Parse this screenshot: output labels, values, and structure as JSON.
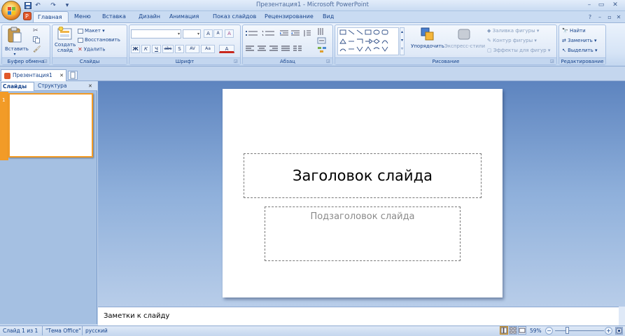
{
  "window": {
    "title": "Презентация1 - Microsoft PowerPoint",
    "minimize": "–",
    "restore": "▭",
    "close": "✕",
    "inner_minimize": "–",
    "inner_restore": "▫",
    "inner_close": "✕",
    "help": "?"
  },
  "qat": {
    "undo": "↶",
    "redo": "↷",
    "customize": "▾"
  },
  "tabs": [
    "Главная",
    "Меню",
    "Вставка",
    "Дизайн",
    "Анимация",
    "Показ слайдов",
    "Рецензирование",
    "Вид"
  ],
  "ribbon": {
    "clipboard": {
      "paste": "Вставить",
      "label": "Буфер обмена"
    },
    "slides": {
      "new_slide": "Создать слайд",
      "layout": "Макет",
      "reset": "Восстановить",
      "delete": "Удалить",
      "label": "Слайды"
    },
    "font": {
      "label": "Шрифт",
      "bold": "Ж",
      "italic": "К",
      "underline": "Ч",
      "strike": "abc",
      "shadow": "S",
      "spacing": "AV",
      "case": "Aa",
      "grow": "A",
      "shrink": "A",
      "clear": "A"
    },
    "paragraph": {
      "label": "Абзац"
    },
    "drawing": {
      "arrange": "Упорядочить",
      "quick_styles": "Экспресс-стили",
      "fill": "Заливка фигуры",
      "outline": "Контур фигуры",
      "effects": "Эффекты для фигур",
      "label": "Рисование"
    },
    "editing": {
      "find": "Найти",
      "replace": "Заменить",
      "select": "Выделить",
      "label": "Редактирование"
    }
  },
  "doc_tab": {
    "name": "Презентация1",
    "close": "✕"
  },
  "panel": {
    "tab_slides": "Слайды",
    "tab_outline": "Структура",
    "close": "✕",
    "slide_number": "1"
  },
  "slide": {
    "title": "Заголовок слайда",
    "subtitle": "Подзаголовок слайда"
  },
  "notes": {
    "placeholder": "Заметки к слайду"
  },
  "status": {
    "slide_info": "Слайд 1 из 1",
    "theme": "\"Тема Office\"",
    "language": "русский",
    "zoom": "59%",
    "zoom_minus": "−",
    "zoom_plus": "+"
  },
  "colors": {
    "accent_orange": "#f29b27",
    "ribbon_text": "#15428b"
  }
}
